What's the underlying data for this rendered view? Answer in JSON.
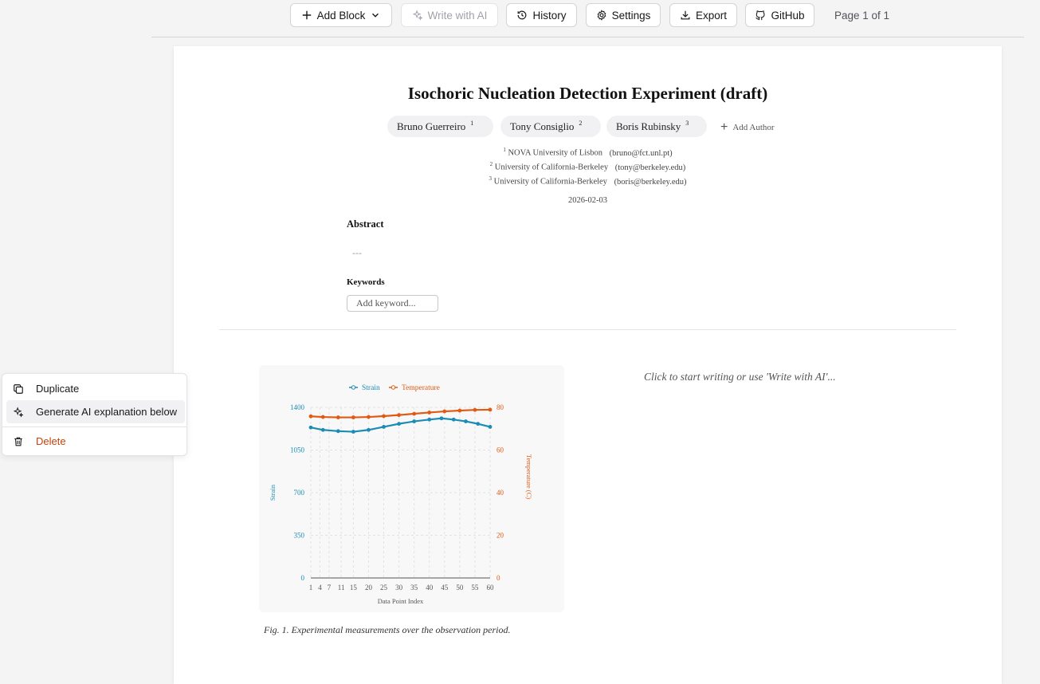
{
  "toolbar": {
    "add_block": "Add Block",
    "write_ai": "Write with AI",
    "history": "History",
    "settings": "Settings",
    "export": "Export",
    "github": "GitHub",
    "page_indicator": "Page 1 of 1"
  },
  "document": {
    "title": "Isochoric Nucleation Detection Experiment (draft)",
    "authors": [
      {
        "name": "Bruno Guerreiro",
        "num": "1"
      },
      {
        "name": "Tony Consiglio",
        "num": "2"
      },
      {
        "name": "Boris Rubinsky",
        "num": "3"
      }
    ],
    "add_author": "Add Author",
    "affiliations": [
      {
        "num": "1",
        "institution": "NOVA University of Lisbon",
        "email": "(bruno@fct.unl.pt)"
      },
      {
        "num": "2",
        "institution": "University of California-Berkeley",
        "email": "(tony@berkeley.edu)"
      },
      {
        "num": "3",
        "institution": "University of California-Berkeley",
        "email": "(boris@berkeley.edu)"
      }
    ],
    "date": "2026-02-03",
    "abstract_label": "Abstract",
    "abstract_text": "---",
    "keywords_label": "Keywords",
    "keyword_placeholder": "Add keyword...",
    "figure_caption": "Fig. 1. Experimental measurements over the observation period.",
    "write_prompt": "Click to start writing or use 'Write with AI'..."
  },
  "chart_data": {
    "type": "line",
    "x_label": "Data Point Index",
    "y_left_label": "Strain",
    "y_right_label": "Temperature (C)",
    "y_left_ticks": [
      "0",
      "350",
      "700",
      "1050",
      "1400"
    ],
    "y_right_ticks": [
      "0",
      "20",
      "40",
      "60",
      "80"
    ],
    "x_ticks": [
      "1",
      "4",
      "7",
      "11",
      "15",
      "20",
      "25",
      "30",
      "35",
      "40",
      "45",
      "50",
      "55",
      "60"
    ],
    "ylim_left": [
      0,
      1400
    ],
    "ylim_right": [
      0,
      80
    ],
    "xlim": [
      1,
      60
    ],
    "legend_position": "top-center",
    "grid": true,
    "colors": {
      "strain": "#1a8cb5",
      "temperature": "#e05a12"
    },
    "series": [
      {
        "name": "Strain",
        "axis": "left",
        "x": [
          1,
          5,
          10,
          15,
          20,
          25,
          30,
          35,
          40,
          44,
          48,
          52,
          56,
          60
        ],
        "values": [
          1235,
          1215,
          1205,
          1200,
          1215,
          1240,
          1265,
          1285,
          1300,
          1310,
          1300,
          1285,
          1265,
          1240
        ]
      },
      {
        "name": "Temperature",
        "axis": "right",
        "x": [
          1,
          5,
          10,
          15,
          20,
          25,
          30,
          35,
          40,
          45,
          50,
          55,
          60
        ],
        "values": [
          75.8,
          75.5,
          75.3,
          75.3,
          75.5,
          75.9,
          76.4,
          77.0,
          77.6,
          78.1,
          78.5,
          78.8,
          78.9
        ]
      }
    ]
  },
  "context_menu": {
    "items": [
      {
        "label": "Duplicate",
        "icon": "copy-icon"
      },
      {
        "label": "Generate AI explanation below",
        "icon": "sparkles-icon"
      },
      {
        "label": "Delete",
        "icon": "trash-icon"
      }
    ]
  }
}
